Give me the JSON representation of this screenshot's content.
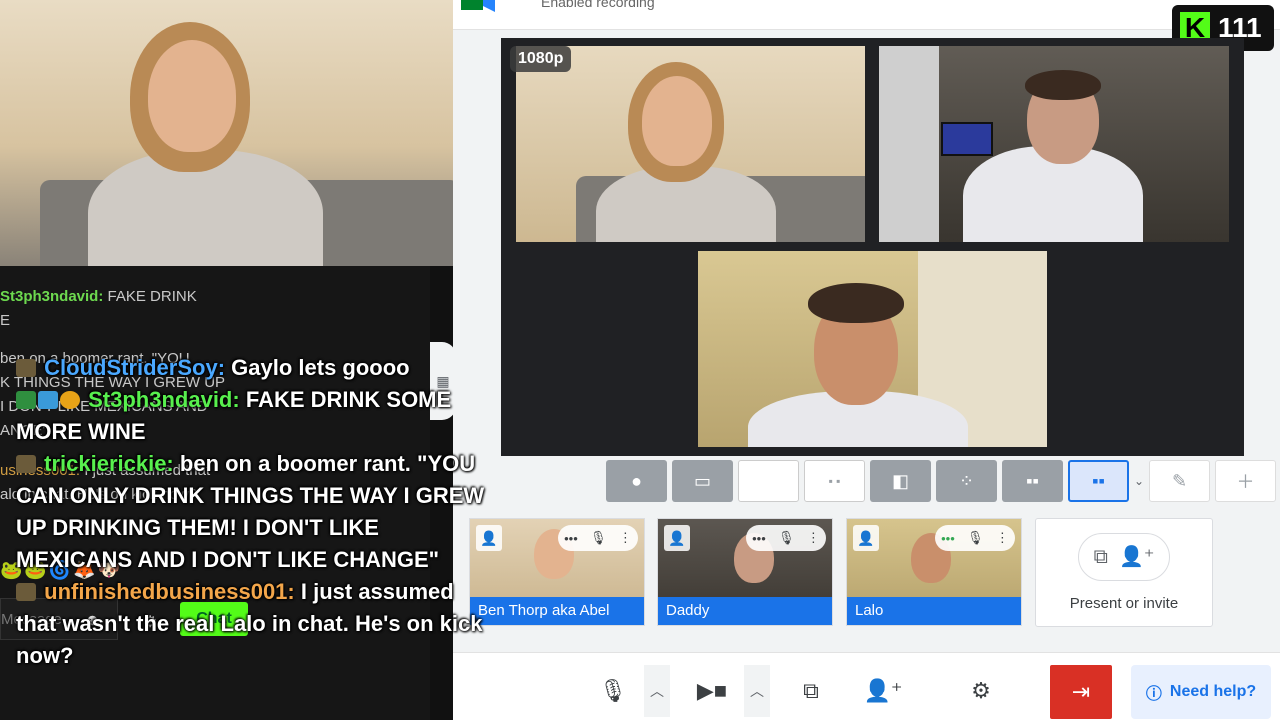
{
  "meet": {
    "top_text": "Enabled recording",
    "resolution_badge": "1080p",
    "participants": [
      {
        "name": "Ben Thorp aka Abel"
      },
      {
        "name": "Daddy"
      },
      {
        "name": "Lalo"
      }
    ],
    "present_label": "Present or invite",
    "help_label": "Need help?",
    "accent_color": "#1a73e8",
    "leave_color": "#d93025"
  },
  "kick": {
    "logo_letter": "K",
    "viewer_count": "111",
    "brand_color": "#53fc18"
  },
  "chat_background": {
    "lines": [
      {
        "user": "St3ph3ndavid:",
        "text": "FAKE DRINK"
      },
      {
        "text": "E"
      },
      {
        "text": "ben on a boomer rant. \"YOU"
      },
      {
        "text": "K THINGS THE WAY I GREW UP"
      },
      {
        "text": "I DON'T LIKE MEXICANS AND"
      },
      {
        "text": "ANGE\""
      },
      {
        "user": "usiness001:",
        "text": "I just assumed that"
      },
      {
        "text": "alo in chat. He's on kick now?"
      }
    ],
    "input_placeholder": "Message",
    "send_label": "Chat"
  },
  "chat_overlay": {
    "messages": [
      {
        "user": "CloudStriderSoy:",
        "text": "Gaylo lets goooo"
      },
      {
        "user": "St3ph3ndavid:",
        "text": "FAKE DRINK SOME MORE WINE"
      },
      {
        "user": "trickierickie:",
        "text": "ben on a boomer rant. \"YOU CAN ONLY DRINK THINGS THE WAY I GREW UP DRINKING THEM! I DON'T LIKE MEXICANS AND I DON'T LIKE CHANGE\""
      },
      {
        "user": "unfinishedbusiness001:",
        "text": "I just assumed that wasn't the real Lalo in chat. He's on kick now?"
      }
    ]
  }
}
